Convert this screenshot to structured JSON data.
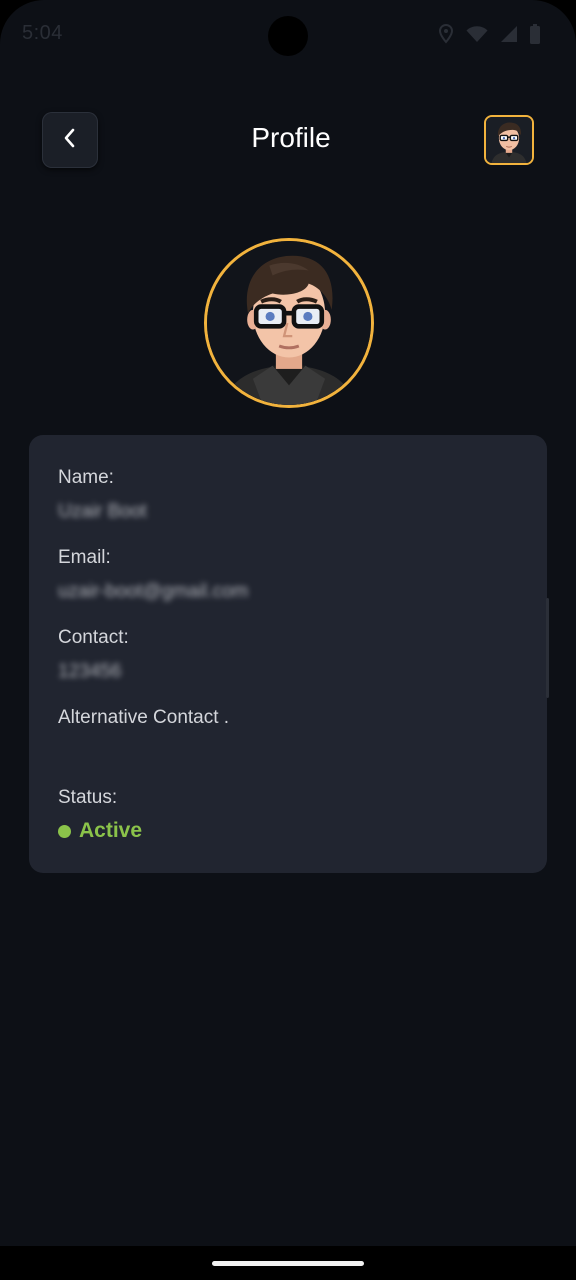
{
  "status_bar": {
    "time": "5:04",
    "icons": [
      "location-icon",
      "wifi-icon",
      "signal-icon",
      "battery-icon"
    ]
  },
  "header": {
    "title": "Profile",
    "back_icon": "chevron-left-icon",
    "avatar_icon": "user-avatar-icon"
  },
  "profile": {
    "avatar_icon": "user-avatar-icon",
    "fields": {
      "name_label": "Name:",
      "name_value": "Uzair Boot",
      "email_label": "Email:",
      "email_value": "uzair-boot@gmail.com",
      "contact_label": "Contact:",
      "contact_value": "123456",
      "alt_contact_label": "Alternative Contact .",
      "status_label": "Status:",
      "status_value": "Active"
    }
  },
  "colors": {
    "background": "#0d1016",
    "card": "#212530",
    "accent": "#f2b33d",
    "status_active": "#8bc34a"
  }
}
